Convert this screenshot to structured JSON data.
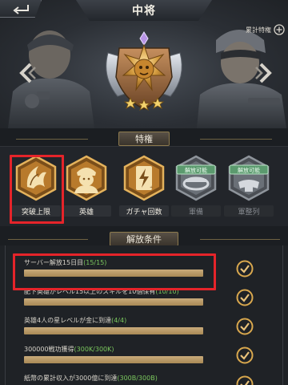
{
  "header": {
    "title": "中将",
    "cumulative_label": "累計特権"
  },
  "icons": {
    "back": "back-arrow-icon",
    "cumulative": "plus-circle-icon",
    "prev": "chevron-left-icon",
    "next": "chevron-right-icon",
    "check": "checkmark-circle-icon"
  },
  "privileges": {
    "title": "特権",
    "items": [
      {
        "label": "突破上限",
        "icon": "flame-claw-icon",
        "locked": false,
        "badge": ""
      },
      {
        "label": "英雄",
        "icon": "soldier-portrait-icon",
        "locked": false,
        "badge": ""
      },
      {
        "label": "ガチャ回数",
        "icon": "lightning-card-icon",
        "locked": false,
        "badge": ""
      },
      {
        "label": "軍備",
        "icon": "armament-icon",
        "locked": true,
        "badge": "解放可能"
      },
      {
        "label": "軍整列",
        "icon": "formation-icon",
        "locked": true,
        "badge": "解放可能"
      }
    ]
  },
  "conditions": {
    "title": "解放条件",
    "items": [
      {
        "text": "サーバー解放15日目",
        "progress": "(15/15)",
        "fraction": 1.0,
        "done": true
      },
      {
        "text": "配下英雄がレベル15以上のスキルを10個保有",
        "progress": "(10/10)",
        "fraction": 1.0,
        "done": true
      },
      {
        "text": "英雄4人の星レベルが金に到達",
        "progress": "(4/4)",
        "fraction": 1.0,
        "done": true
      },
      {
        "text": "300000戦功獲得",
        "progress": "(300K/300K)",
        "fraction": 1.0,
        "done": true
      },
      {
        "text": "紙幣の累計収入が3000億に到達",
        "progress": "(300B/300B)",
        "fraction": 1.0,
        "done": true
      }
    ]
  },
  "colors": {
    "accent_gold": "#c9ab7b",
    "progress_green": "#7bc85e",
    "highlight_red": "#e5242a"
  }
}
